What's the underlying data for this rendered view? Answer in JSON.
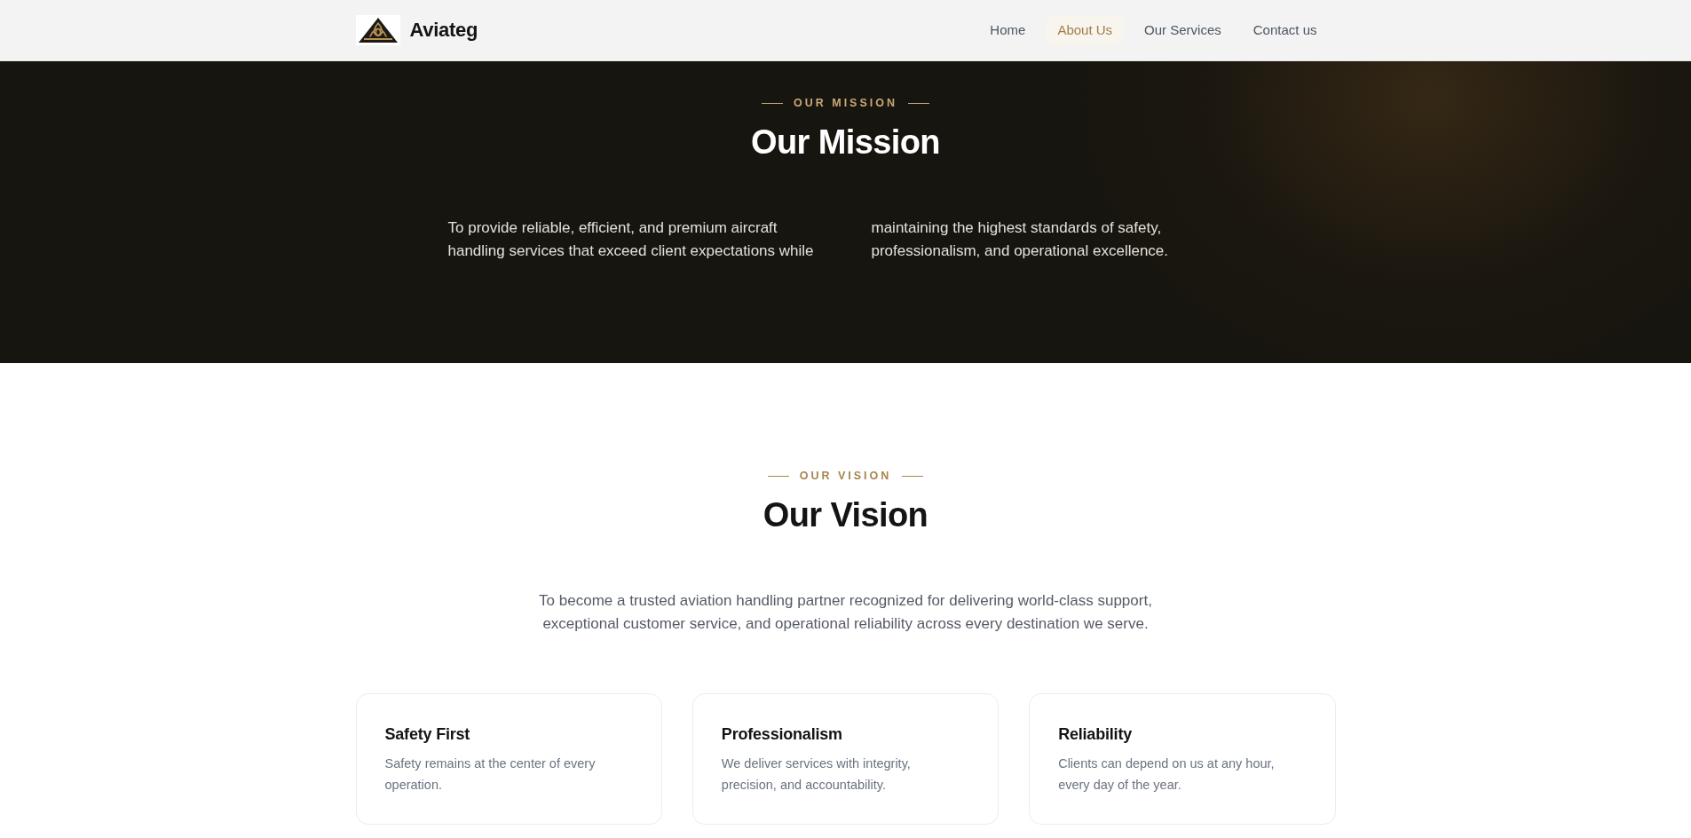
{
  "header": {
    "brand": "Aviateg",
    "nav": [
      {
        "label": "Home",
        "selected": false
      },
      {
        "label": "About Us",
        "selected": true
      },
      {
        "label": "Our Services",
        "selected": false
      },
      {
        "label": "Contact us",
        "selected": false
      }
    ]
  },
  "mission": {
    "eyebrow": "OUR MISSION",
    "title": "Our Mission",
    "text": "To provide reliable, efficient, and premium aircraft handling services that exceed client expectations while maintaining the highest standards of safety, professionalism, and operational excellence."
  },
  "vision": {
    "eyebrow": "OUR VISION",
    "title": "Our Vision",
    "text": "To become a trusted aviation handling partner recognized for delivering world-class support, exceptional customer service, and operational reliability across every destination we serve.",
    "values": [
      {
        "title": "Safety First",
        "text": "Safety remains at the center of every operation."
      },
      {
        "title": "Professionalism",
        "text": "We deliver services with integrity, precision, and accountability."
      },
      {
        "title": "Reliability",
        "text": "Clients can depend on us at any hour, every day of the year."
      }
    ]
  }
}
